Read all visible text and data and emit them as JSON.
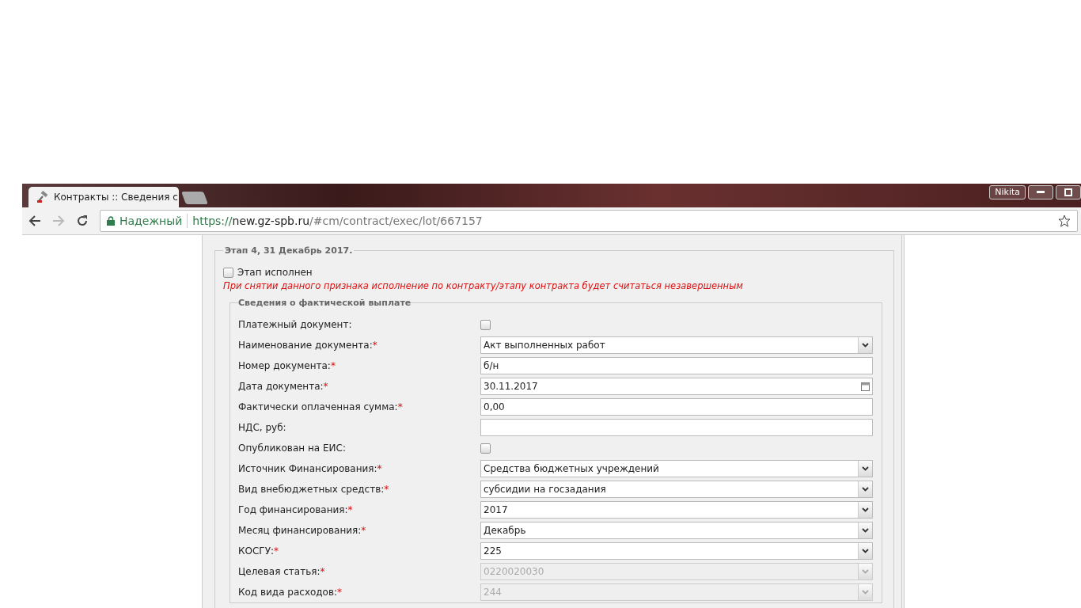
{
  "browser": {
    "tab": {
      "title": "Контракты :: Сведения с",
      "selected": true
    },
    "user": "Nikita",
    "url": {
      "security": "Надежный",
      "scheme": "https://",
      "host": "new.gz-spb.ru",
      "path": "/#cm/contract/exec/lot/667157"
    }
  },
  "stage": {
    "title": "Этап 4, 31 Декабрь 2017.",
    "completed": {
      "label": "Этап исполнен",
      "checked": false
    },
    "warning": "При снятии данного признака исполнение по контракту/этапу контракта будет считаться незавершенным",
    "payment": {
      "title": "Сведения о фактической выплате",
      "rows": [
        {
          "kind": "checkbox",
          "label": "Платежный документ:",
          "checked": false
        },
        {
          "kind": "select",
          "label": "Наименование документа:",
          "mark": "*",
          "value": "Акт выполненных работ",
          "disabled": false
        },
        {
          "kind": "text",
          "label": "Номер документа:",
          "mark": "*",
          "value": "б/н"
        },
        {
          "kind": "date",
          "label": "Дата документа:",
          "mark": "*",
          "value": "30.11.2017"
        },
        {
          "kind": "text",
          "label": "Фактически оплаченная сумма:",
          "mark": "*",
          "value": "0,00"
        },
        {
          "kind": "text",
          "label": "НДС, руб:"
        },
        {
          "kind": "checkbox",
          "label": "Опубликован на ЕИС:",
          "checked": false
        },
        {
          "kind": "select",
          "label": "Источник Финансирования:",
          "mark": "*",
          "value": "Средства бюджетных учреждений",
          "disabled": false
        },
        {
          "kind": "select",
          "label": "Вид внебюджетных средств:",
          "mark": "*",
          "value": "субсидии на госзадания",
          "disabled": false
        },
        {
          "kind": "select",
          "label": "Год финансирования:",
          "mark": "*",
          "value": "2017",
          "disabled": false
        },
        {
          "kind": "select",
          "label": "Месяц финансирования:",
          "mark": "*",
          "value": "Декабрь",
          "disabled": false
        },
        {
          "kind": "select",
          "label": "КОСГУ:",
          "mark": "*",
          "value": "225",
          "disabled": false
        },
        {
          "kind": "select",
          "label": "Целевая статья:",
          "mark": "*",
          "value": "0220020030",
          "disabled": true
        },
        {
          "kind": "select",
          "label": "Код вида расходов:",
          "mark": "*",
          "value": "244",
          "disabled": true
        }
      ]
    }
  }
}
